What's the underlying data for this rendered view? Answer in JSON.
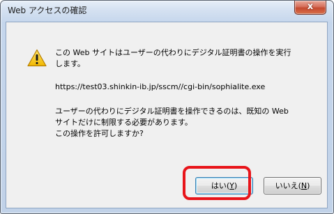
{
  "window": {
    "title": "Web アクセスの確認",
    "close_glyph": "x"
  },
  "message": {
    "line1": "この Web サイトはユーザーの代わりにデジタル証明書の操作を実行",
    "line2": "します。",
    "url": "https://test03.shinkin-ib.jp/sscm//cgi-bin/sophialite.exe",
    "note1": "ユーザーの代わりにデジタル証明書を操作できるのは、既知の Web",
    "note2": "サイトだけに制限する必要があります。",
    "note3": "この操作を許可しますか?"
  },
  "buttons": {
    "yes": {
      "label": "はい(",
      "accel": "Y",
      "suffix": ")"
    },
    "no": {
      "label": "いいえ(",
      "accel": "N",
      "suffix": ")"
    }
  },
  "icons": {
    "warning": "warning-icon",
    "close": "close-icon"
  },
  "colors": {
    "highlight": "#e8141a",
    "warning_fill": "#f2c200",
    "close_button": "#c54a30"
  }
}
